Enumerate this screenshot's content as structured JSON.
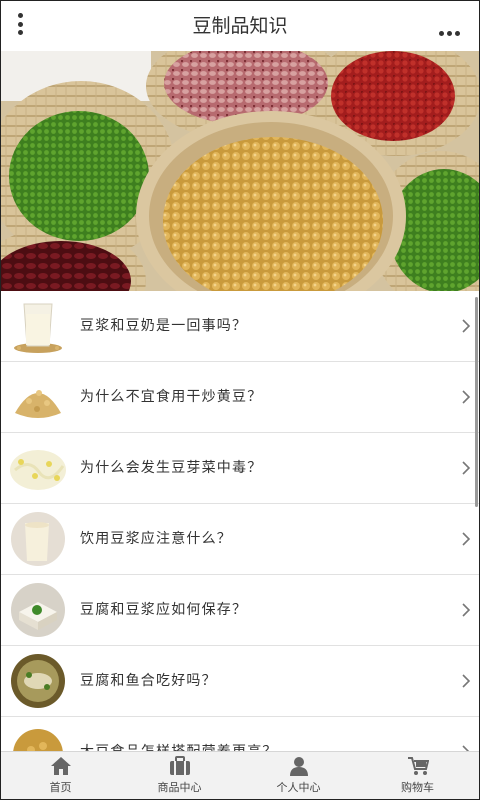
{
  "header": {
    "title": "豆制品知识",
    "menu_icon": "vertical-dots-icon",
    "more_icon": "horizontal-dots-icon"
  },
  "banner": {
    "description_icon": "beans-banner-image"
  },
  "articles": [
    {
      "title": "豆浆和豆奶是一回事吗？",
      "thumb": "soy-milk-glass"
    },
    {
      "title": "为什么不宜食用干炒黄豆？",
      "thumb": "soybeans-pile"
    },
    {
      "title": "为什么会发生豆芽菜中毒？",
      "thumb": "bean-sprouts"
    },
    {
      "title": "饮用豆浆应注意什么？",
      "thumb": "soy-milk-jug"
    },
    {
      "title": "豆腐和豆浆应如何保存？",
      "thumb": "tofu-block"
    },
    {
      "title": "豆腐和鱼合吃好吗？",
      "thumb": "fish-tofu-dish"
    },
    {
      "title": "大豆食品怎样搭配营养更高？",
      "thumb": "soybean-food"
    }
  ],
  "footer": {
    "tabs": [
      {
        "label": "首页",
        "icon": "home-icon"
      },
      {
        "label": "商品中心",
        "icon": "bag-icon"
      },
      {
        "label": "个人中心",
        "icon": "user-icon"
      },
      {
        "label": "购物车",
        "icon": "cart-icon"
      }
    ]
  },
  "colors": {
    "text": "#333333",
    "footer_bg": "#f2f2f2",
    "divider": "#e1e1e1"
  }
}
